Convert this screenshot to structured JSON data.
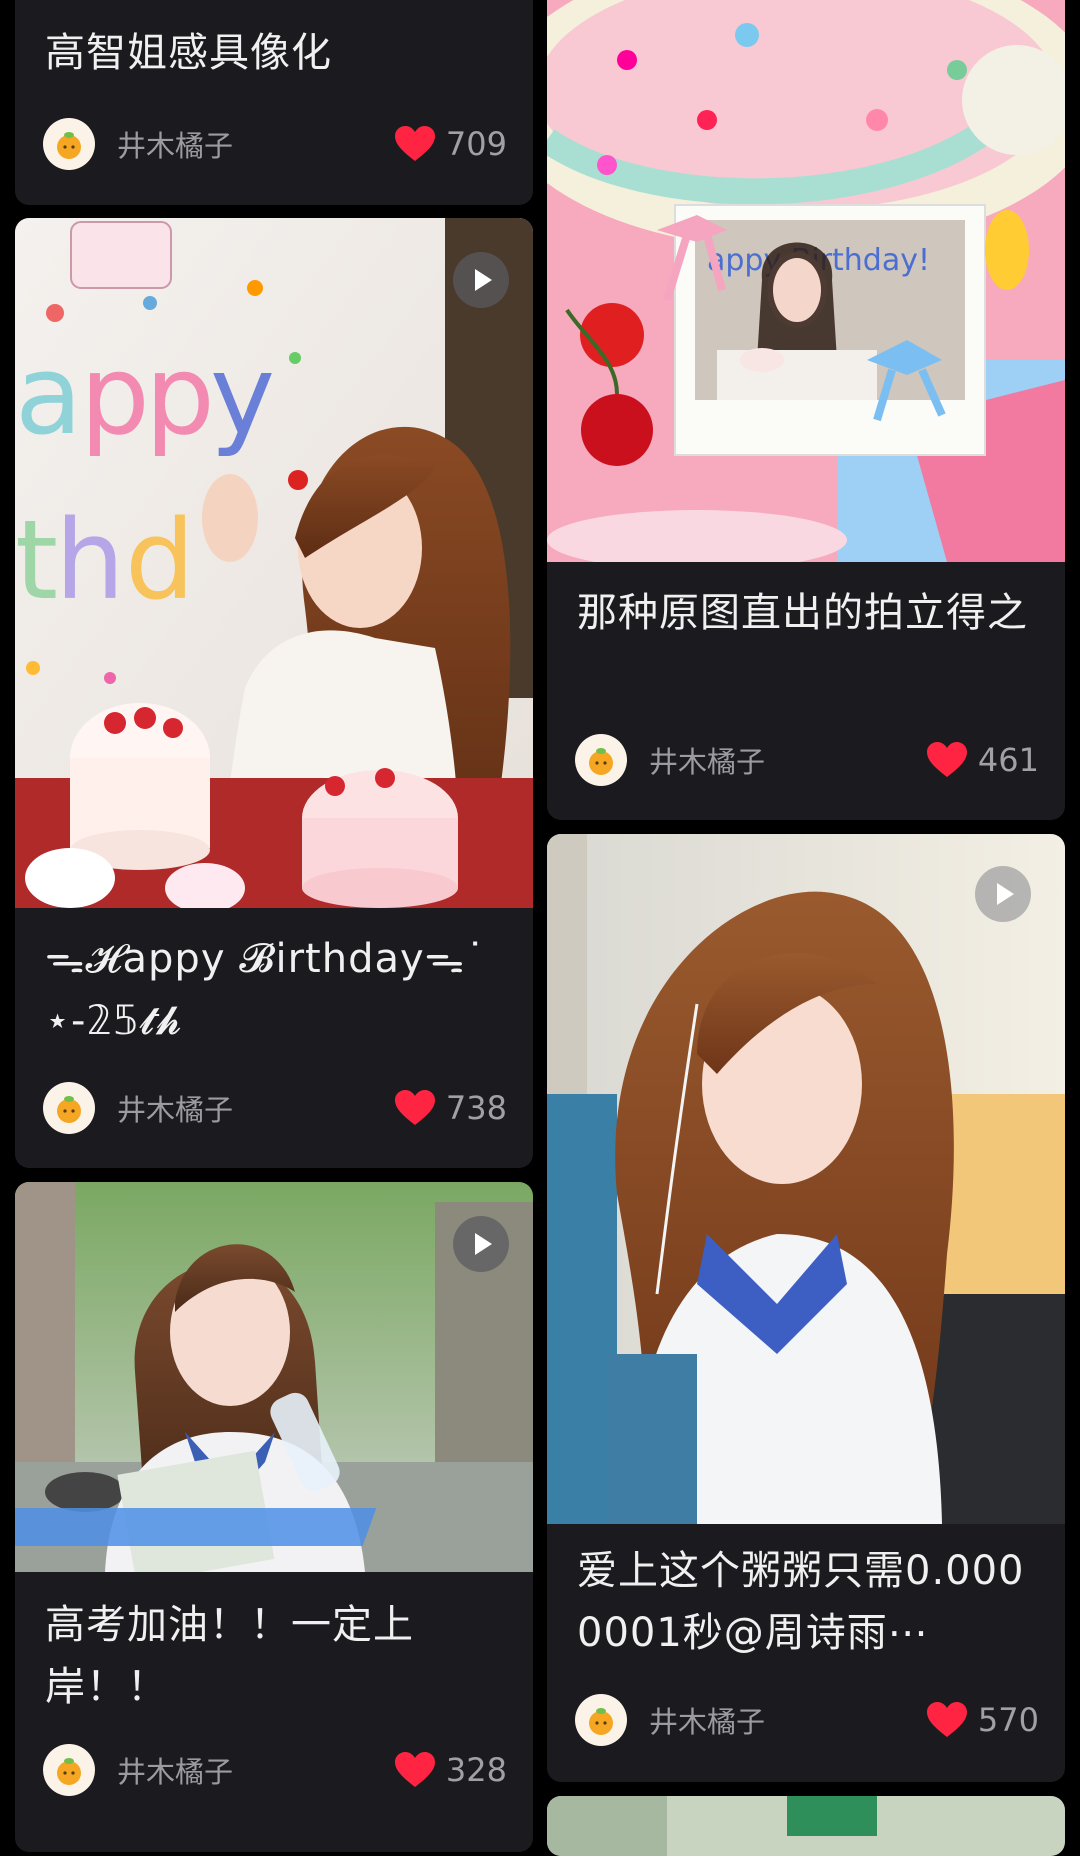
{
  "feed": {
    "left": [
      {
        "title": "高智姐感具像化",
        "author": "井木橘子",
        "likes": "709",
        "has_video": false
      },
      {
        "title": "ᯓ𝓗appy 𝓑irthdayᯓ˙⋆-𝟚𝟝𝓽𝓱",
        "author": "井木橘子",
        "likes": "738",
        "has_video": true,
        "image_text": "appy thda"
      },
      {
        "title": "高考加油！！一定上岸！！",
        "author": "井木橘子",
        "likes": "328",
        "has_video": true
      }
    ],
    "right": [
      {
        "title": "那种原图直出的拍立得之",
        "author": "井木橘子",
        "likes": "461",
        "has_video": false,
        "image_text": "appy Birthday!"
      },
      {
        "title": "爱上这个粥粥只需0.0000001秒@周诗雨⋯",
        "author": "井木橘子",
        "likes": "570",
        "has_video": true
      }
    ]
  },
  "icons": {
    "like": "heart-icon",
    "video": "play-icon",
    "avatar": "orange-mascot-icon"
  },
  "colors": {
    "background": "#000000",
    "card": "#1b1b1f",
    "heart": "#ff2442",
    "text": "#f0f0f0",
    "muted": "#9b9ba0"
  }
}
